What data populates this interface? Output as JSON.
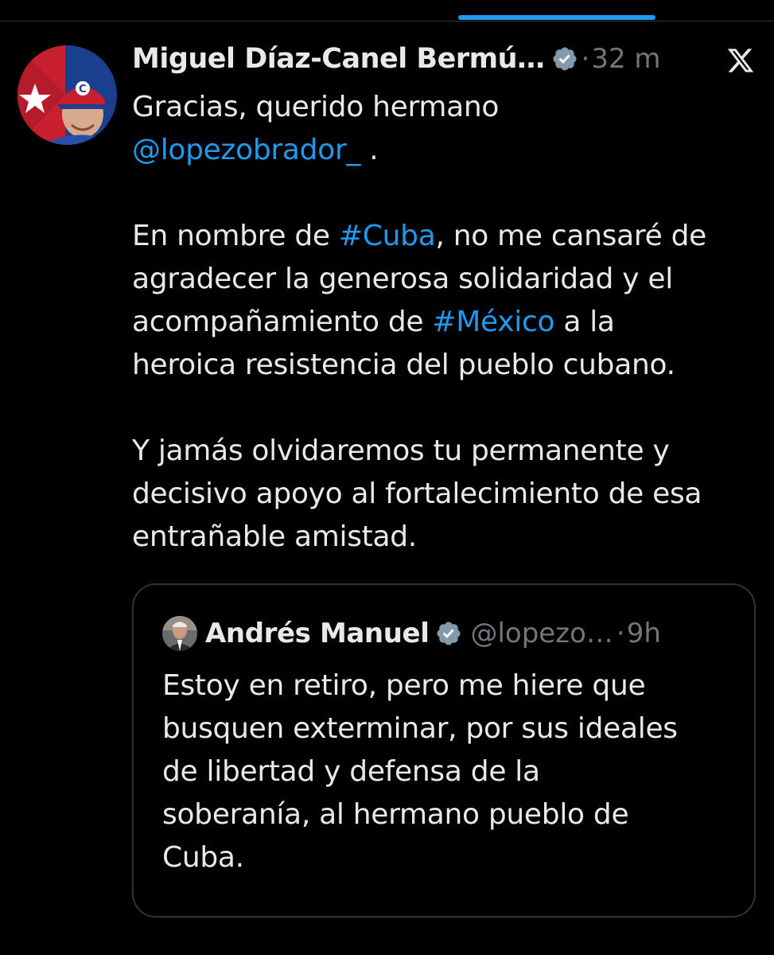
{
  "colors": {
    "background": "#000000",
    "text": "#e7e9ea",
    "secondary_text": "#71767b",
    "link": "#1d9bf0",
    "border": "#2f3336",
    "verified_badge": "#829aab"
  },
  "icons": {
    "verified": "verified-badge-icon",
    "platform": "x-logo-icon"
  },
  "tweet": {
    "author_name": "Miguel Díaz-Canel Bermú…",
    "separator": "·",
    "time": "32 m",
    "lines": {
      "l1": "Gracias, querido hermano",
      "l2_mention": "@lopezobrador_",
      "l2_end": " .",
      "l3_start": "En nombre de ",
      "l3_hashtag": "#Cuba",
      "l3_end": ", no me cansaré de",
      "l4": "agradecer la generosa solidaridad y el",
      "l5_start": "acompañamiento de ",
      "l5_hashtag": "#México",
      "l5_end": " a la",
      "l6": "heroica resistencia del pueblo cubano.",
      "l7": "Y jamás olvidaremos tu permanente y",
      "l8": "decisivo apoyo al fortalecimiento de esa",
      "l9": "entrañable amistad."
    }
  },
  "quoted_tweet": {
    "author_name": "Andrés Manuel",
    "handle": "@lopezo…",
    "separator": "·",
    "time": "9h",
    "lines": {
      "l1": "Estoy en retiro, pero me hiere que",
      "l2": "busquen exterminar, por sus ideales",
      "l3": "de libertad y defensa de la",
      "l4": "soberanía, al hermano pueblo de",
      "l5": "Cuba."
    }
  }
}
